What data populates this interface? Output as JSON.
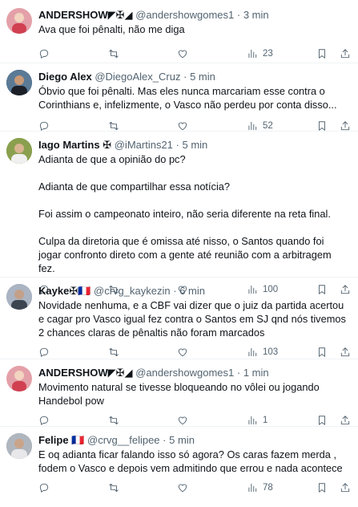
{
  "tweets": [
    {
      "name": "ANDERSHOW",
      "name_suffix": "◤✠◢",
      "handle": "@andershowgomes1",
      "time": "3 min",
      "paragraphs": [
        "Ava que foi pênalti, não me diga"
      ],
      "views": "23",
      "avatar_color": "#e4a0a8"
    },
    {
      "name": "Diego Alex",
      "name_suffix": "",
      "handle": "@DiegoAlex_Cruz",
      "time": "5 min",
      "paragraphs": [
        "Óbvio que foi pênalti. Mas eles nunca marcariam esse contra o Corinthians e, infelizmente, o Vasco não perdeu por conta disso..."
      ],
      "views": "52",
      "avatar_color": "#2c3440"
    },
    {
      "name": "Iago Martins",
      "name_suffix": "✠",
      "handle": "@iMartins21",
      "time": "5 min",
      "paragraphs": [
        "Adianta de que a opinião do pc?",
        "Adianta de que compartilhar essa notícia?",
        "Foi assim o campeonato inteiro, não seria diferente na reta final.",
        "Culpa da diretoria que é omissa até nisso, o Santos quando foi jogar confronto direto com a gente até reunião com a arbitragem fez."
      ],
      "views": "100",
      "avatar_color": "#7a8f4a"
    },
    {
      "name": "Kayke",
      "name_suffix": "✠🇫🇷",
      "handle": "@crvg_kaykezin",
      "time": "6 min",
      "paragraphs": [
        "Novidade nenhuma, e a CBF vai dizer que o juiz da partida acertou e cagar pro Vasco igual fez contra o Santos em SJ qnd nós tivemos 2 chances claras de pênaltis não foram marcados"
      ],
      "views": "103",
      "avatar_color": "#8a96a6"
    },
    {
      "name": "ANDERSHOW",
      "name_suffix": "◤✠◢",
      "handle": "@andershowgomes1",
      "time": "1 min",
      "paragraphs": [
        "Movimento natural se tivesse bloqueando no vôlei ou jogando Handebol pow"
      ],
      "views": "1",
      "avatar_color": "#e4a0a8"
    },
    {
      "name": "Felipe",
      "name_suffix": "🇫🇷",
      "handle": "@crvg__felipee",
      "time": "5 min",
      "paragraphs": [
        "E oq adianta ficar falando isso só agora? Os caras fazem merda , fodem o Vasco e depois vem admitindo que errou e nada acontece"
      ],
      "views": "78",
      "avatar_color": "#9aa0a8"
    }
  ],
  "ui": {
    "dot": "·"
  }
}
